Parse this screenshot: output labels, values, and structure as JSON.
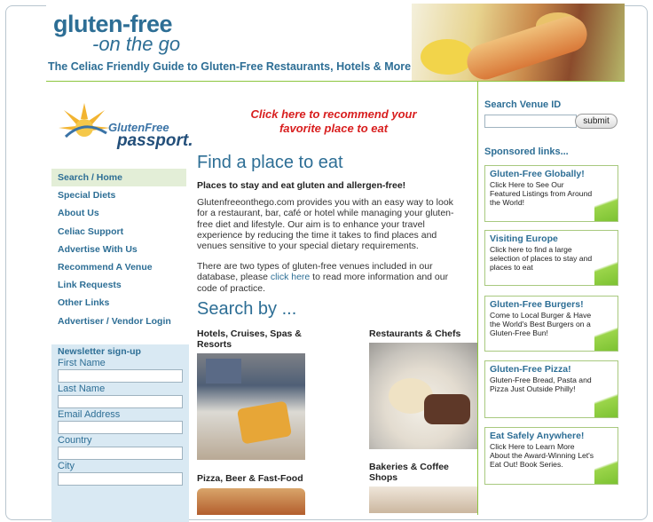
{
  "header": {
    "logo_line1": "gluten-free",
    "logo_line2": "-on the go",
    "tagline": "The Celiac Friendly Guide to Gluten-Free Restaurants, Hotels & More"
  },
  "passport_logo": {
    "line1": "GlutenFree",
    "line2": "passport."
  },
  "nav": {
    "items": [
      "Search / Home",
      "Special Diets",
      "About Us",
      "Celiac Support",
      "Advertise With Us",
      "Recommend A Venue",
      "Link Requests",
      "Other Links",
      "Advertiser / Vendor Login"
    ]
  },
  "newsletter": {
    "title": "Newsletter sign-up",
    "fields": [
      "First Name",
      "Last Name",
      "Email Address",
      "Country",
      "City"
    ]
  },
  "main": {
    "recommend_line1": "Click here to recommend your",
    "recommend_line2": "favorite place to eat",
    "heading": "Find a place to eat",
    "intro_bold": "Places to stay and eat gluten and allergen-free!",
    "para1": "Glutenfreeonthego.com provides you with an easy way to look for a restaurant, bar, café or hotel while managing your gluten-free diet and lifestyle. Our aim is to enhance your travel experience by reducing the time it takes to find places and venues sensitive to your special dietary requirements.",
    "para2_before": "There are two types of gluten-free venues included in our database, please ",
    "para2_link": "click here",
    "para2_after": " to read more information and our code of practice.",
    "search_heading": "Search by ...",
    "categories": {
      "hotels": "Hotels, Cruises, Spas & Resorts",
      "restaurants": "Restaurants & Chefs",
      "pizza": "Pizza, Beer & Fast-Food",
      "bakeries": "Bakeries & Coffee Shops"
    }
  },
  "right": {
    "search_title": "Search Venue ID",
    "submit_label": "submit",
    "sponsored_title": "Sponsored links...",
    "ads": [
      {
        "title": "Gluten-Free Globally!",
        "body": "Click Here to See Our Featured Listings from Around the World!"
      },
      {
        "title": "Visiting Europe",
        "body": "Click here to find a large selection of places to stay and places to eat"
      },
      {
        "title": "Gluten-Free Burgers!",
        "body": "Come to Local Burger & Have the World's Best Burgers on a Gluten-Free Bun!"
      },
      {
        "title": "Gluten-Free Pizza!",
        "body": "Gluten-Free Bread, Pasta and Pizza Just Outside Philly!"
      },
      {
        "title": "Eat Safely Anywhere!",
        "body": "Click Here to Learn More About the Award-Winning Let's Eat Out! Book Series."
      }
    ]
  },
  "colors": {
    "brand_blue": "#2d6e95",
    "accent_green": "#8dc63f",
    "recommend_red": "#d81e1e"
  }
}
